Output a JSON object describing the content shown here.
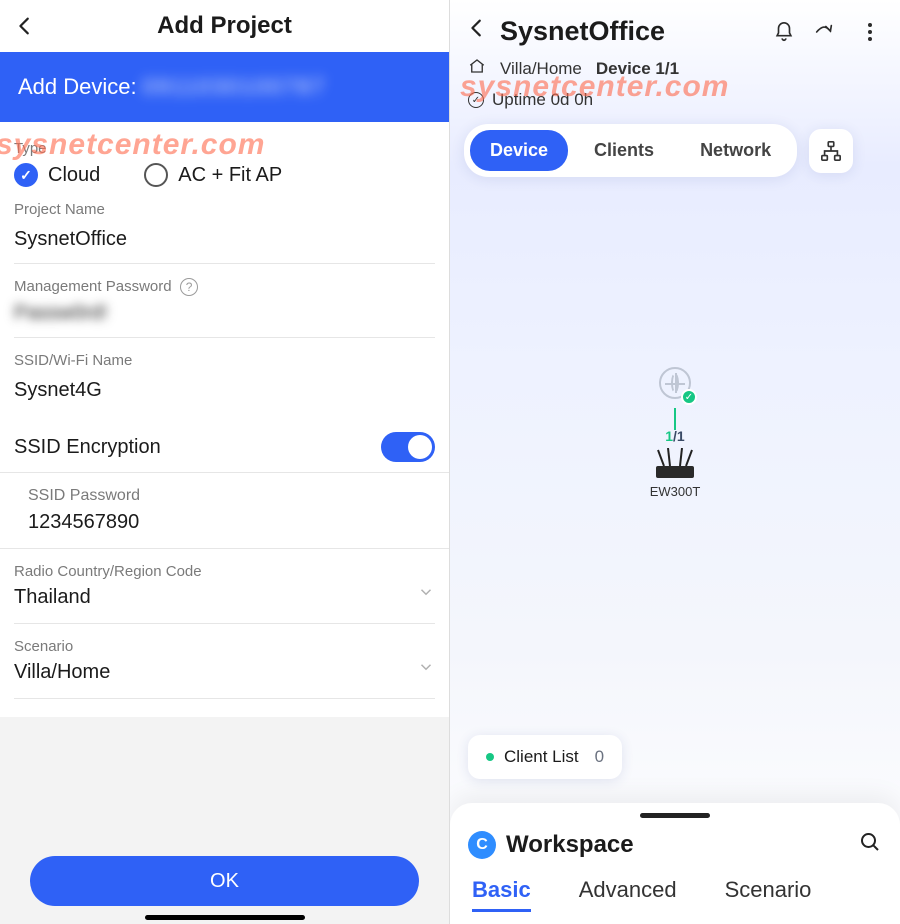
{
  "watermark": "sysnetcenter.com",
  "left": {
    "title": "Add Project",
    "blue_bar_prefix": "Add Device:",
    "blue_bar_masked": "0911030100787",
    "type_label": "Type",
    "radios": {
      "cloud": "Cloud",
      "acfit": "AC + Fit AP",
      "selected": "cloud"
    },
    "project_name_label": "Project Name",
    "project_name_value": "SysnetOffice",
    "mgmt_pw_label": "Management Password",
    "mgmt_pw_masked": "Passw0rd!",
    "ssid_label": "SSID/Wi-Fi Name",
    "ssid_value": "Sysnet4G",
    "ssid_enc_label": "SSID Encryption",
    "ssid_pw_label": "SSID Password",
    "ssid_pw_value": "1234567890",
    "country_label": "Radio Country/Region Code",
    "country_value": "Thailand",
    "scenario_label": "Scenario",
    "scenario_value": "Villa/Home",
    "ok_label": "OK"
  },
  "right": {
    "title": "SysnetOffice",
    "scenario": "Villa/Home",
    "device_count": "Device 1/1",
    "uptime": "Uptime 0d 0h",
    "segments": {
      "device": "Device",
      "clients": "Clients",
      "network": "Network",
      "active": "device"
    },
    "node": {
      "online": "1",
      "total": "/1",
      "model": "EW300T"
    },
    "client_list_label": "Client List",
    "client_list_count": "0",
    "workspace_label": "Workspace",
    "tabs": {
      "basic": "Basic",
      "advanced": "Advanced",
      "scenario": "Scenario",
      "active": "basic"
    }
  }
}
